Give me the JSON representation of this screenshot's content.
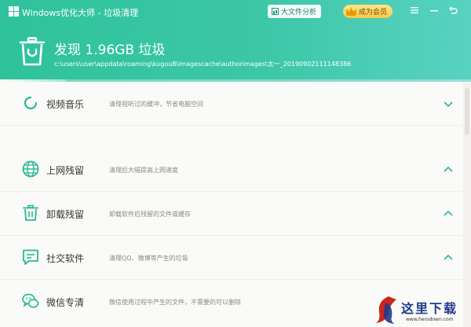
{
  "window": {
    "title": "Windows优化大师 - 垃圾清理",
    "analyze_label": "大文件分析",
    "vip_label": "成为会员",
    "menu_icon": "menu-icon",
    "minimize_icon": "minimize-icon",
    "back_icon": "back-icon"
  },
  "scan": {
    "title": "发现 1.96GB 垃圾",
    "path": "c:\\users\\user\\appdata\\roaming\\kugou8\\imagescache\\authorimages\\太一_20190902111148386",
    "progress_fraction": 0.14
  },
  "items": [
    {
      "name": "视频音乐",
      "desc": "清理视听过的缓冲，节省电脑空间",
      "icon": "loading-spinner-icon",
      "expanded": false
    },
    {
      "name": "上网残留",
      "desc": "清理后大幅提高上网速度",
      "icon": "globe-icon",
      "expanded": true
    },
    {
      "name": "卸载残留",
      "desc": "卸载软件后残留的文件或缓存",
      "icon": "trash-icon",
      "expanded": true
    },
    {
      "name": "社交软件",
      "desc": "清理QQ、微博等产生的垃圾",
      "icon": "chat-icon",
      "expanded": true
    },
    {
      "name": "微信专清",
      "desc": "微信使用过程中产生的文件，不需要的可以删除",
      "icon": "wechat-icon",
      "expanded": false
    }
  ],
  "watermark": {
    "text": "这里下载",
    "url": "www.herodown.com"
  },
  "colors": {
    "accent": "#2fc29c",
    "item_icon": "#2bb994",
    "vip_gold": "#f7c94a"
  }
}
